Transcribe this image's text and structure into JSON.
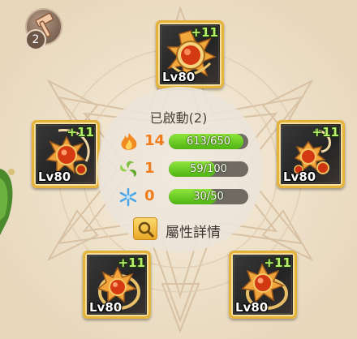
{
  "hammer_button": {
    "badge": "2",
    "icon": "hammer-icon"
  },
  "equipment": [
    {
      "id": "top",
      "plus": "+11",
      "level": "Lv80",
      "icon": "sun-amulet-icon"
    },
    {
      "id": "left",
      "plus": "+11",
      "level": "Lv80",
      "icon": "sun-pendant-icon"
    },
    {
      "id": "right",
      "plus": "+11",
      "level": "Lv80",
      "icon": "sun-earring-icon"
    },
    {
      "id": "bottom-left",
      "plus": "+11",
      "level": "Lv80",
      "icon": "sun-ring-icon"
    },
    {
      "id": "bottom-right",
      "plus": "+11",
      "level": "Lv80",
      "icon": "sun-ring-icon"
    }
  ],
  "center": {
    "title": "已啟動(2)",
    "stats": [
      {
        "element": "fire",
        "icon": "fire-icon",
        "level": "14",
        "progress": "613/650",
        "fill": 0.943
      },
      {
        "element": "wind",
        "icon": "wind-icon",
        "level": "1",
        "progress": "59/100",
        "fill": 0.59
      },
      {
        "element": "ice",
        "icon": "snowflake-icon",
        "level": "0",
        "progress": "30/50",
        "fill": 0.6
      }
    ],
    "detail_button": {
      "label": "屬性詳情",
      "icon": "search-icon"
    }
  },
  "colors": {
    "background": "#efe3cc",
    "frame_gold": "#e5b23a",
    "bar_green": "#6ccf25",
    "level_orange": "#ef7d1d",
    "plus_green": "#b6f06a"
  }
}
